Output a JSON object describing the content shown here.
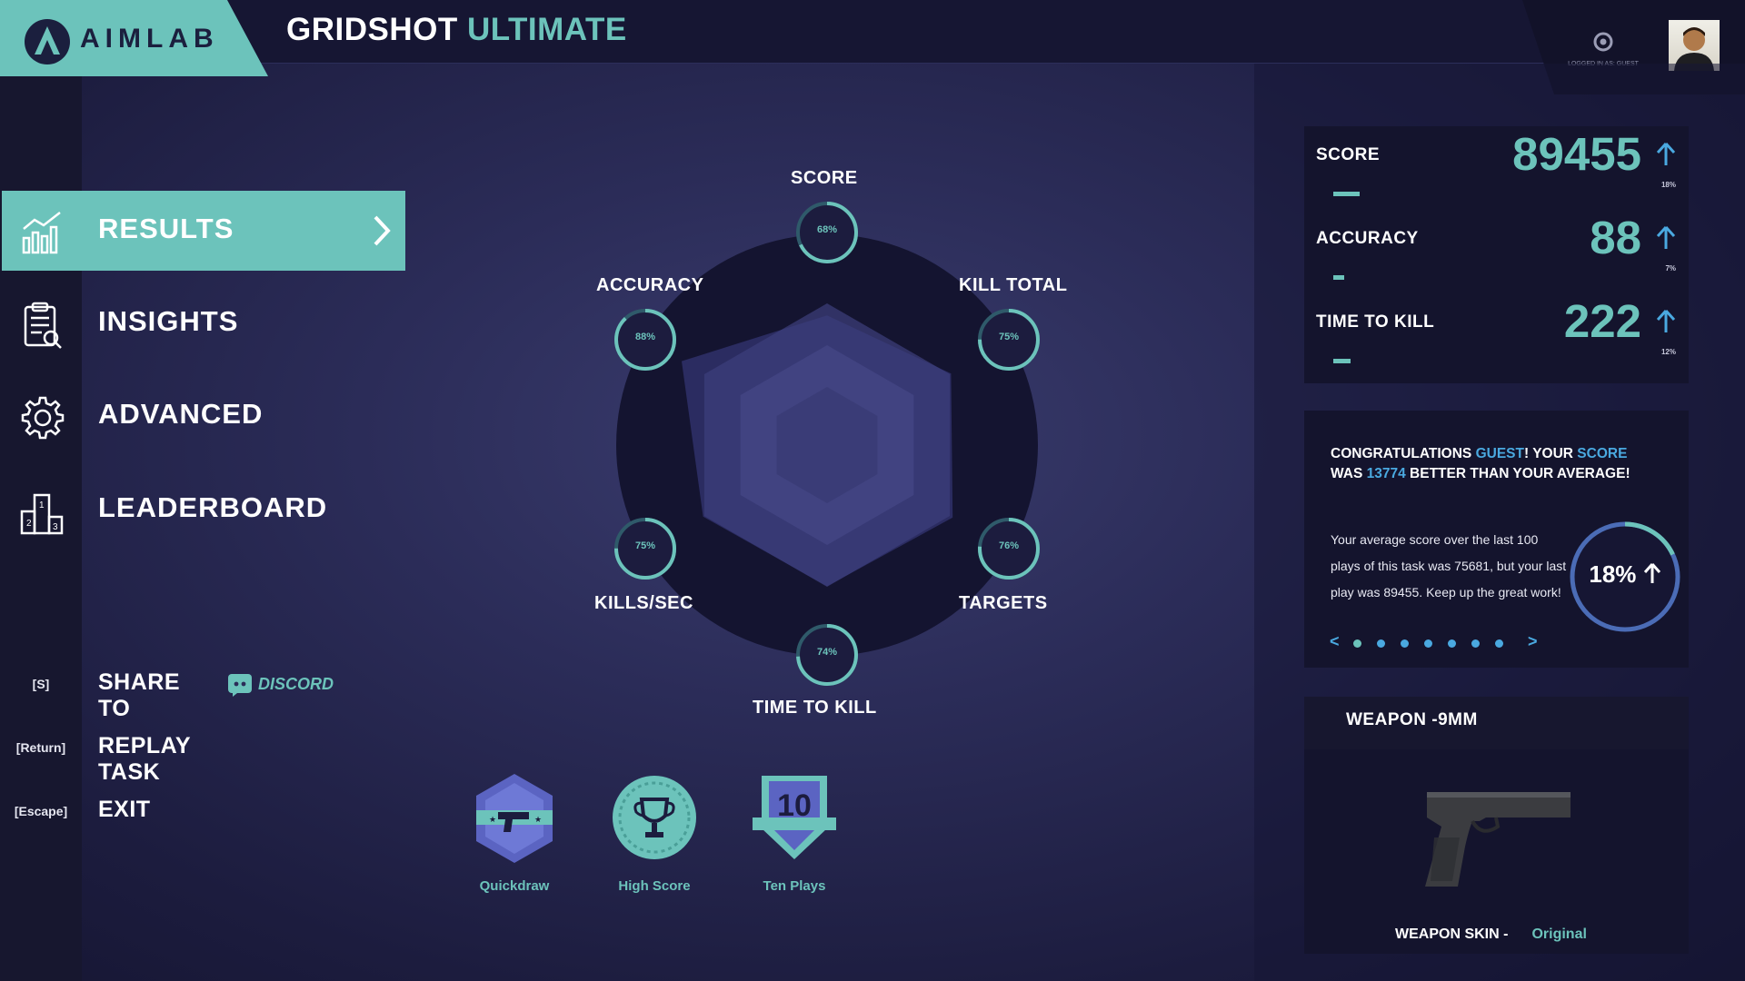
{
  "app": {
    "logo_text": "AIMLAB",
    "task_title_part1": "GRIDSHOT",
    "task_title_part2": "ULTIMATE",
    "logged_in_text": "LOGGED IN AS: GUEST"
  },
  "colors": {
    "accent": "#6cc3bb",
    "highlight_blue": "#4aa9e0",
    "background": "#2b2c58",
    "panel": "#14142d"
  },
  "sidebar": {
    "nav": [
      {
        "label": "RESULTS",
        "icon": "chart-icon",
        "active": true
      },
      {
        "label": "INSIGHTS",
        "icon": "clipboard-icon",
        "active": false
      },
      {
        "label": "ADVANCED",
        "icon": "gear-icon",
        "active": false
      },
      {
        "label": "LEADERBOARD",
        "icon": "podium-icon",
        "active": false
      }
    ],
    "actions": [
      {
        "key": "[S]",
        "label": "SHARE TO"
      },
      {
        "key": "[Return]",
        "label": "REPLAY TASK"
      },
      {
        "key": "[Escape]",
        "label": "EXIT"
      }
    ],
    "discord_label": "DISCORD"
  },
  "radar": {
    "axes": [
      {
        "label": "SCORE",
        "percent": "68%",
        "value": 0.68
      },
      {
        "label": "KILL TOTAL",
        "percent": "75%",
        "value": 0.75
      },
      {
        "label": "TARGETS",
        "percent": "76%",
        "value": 0.76
      },
      {
        "label": "TIME TO KILL",
        "percent": "74%",
        "value": 0.74
      },
      {
        "label": "KILLS/SEC",
        "percent": "75%",
        "value": 0.75
      },
      {
        "label": "ACCURACY",
        "percent": "88%",
        "value": 0.88
      }
    ]
  },
  "badges": [
    {
      "name": "Quickdraw",
      "icon": "pistol-badge-icon"
    },
    {
      "name": "High Score",
      "icon": "trophy-badge-icon"
    },
    {
      "name": "Ten Plays",
      "icon": "ten-plays-badge-icon",
      "number": "10"
    }
  ],
  "stats": [
    {
      "name": "SCORE",
      "value": "89455",
      "change": "18%",
      "trend": "up",
      "bar_fraction": 0.18
    },
    {
      "name": "ACCURACY",
      "value": "88",
      "change": "7%",
      "trend": "up",
      "bar_fraction": 0.07
    },
    {
      "name": "TIME TO KILL",
      "value": "222",
      "change": "12%",
      "trend": "up",
      "bar_fraction": 0.12
    }
  ],
  "congrats": {
    "head_1": "CONGRATULATIONS ",
    "head_name": "GUEST",
    "head_2": "! YOUR ",
    "head_score_word": "SCORE",
    "head_3": " WAS ",
    "head_amount": "13774",
    "head_4": " BETTER THAN YOUR AVERAGE!",
    "body": "Your average score over the last 100 plays of this task was 75681, but your last play was 89455. Keep up the great work!",
    "ring_text": "18%",
    "ring_fraction": 0.18,
    "carousel_prev": "<",
    "carousel_next": ">",
    "carousel_dots": 7,
    "carousel_active_index": 0
  },
  "weapon": {
    "title": "WEAPON -9MM",
    "skin_label": "WEAPON SKIN -",
    "skin_value": "Original"
  }
}
